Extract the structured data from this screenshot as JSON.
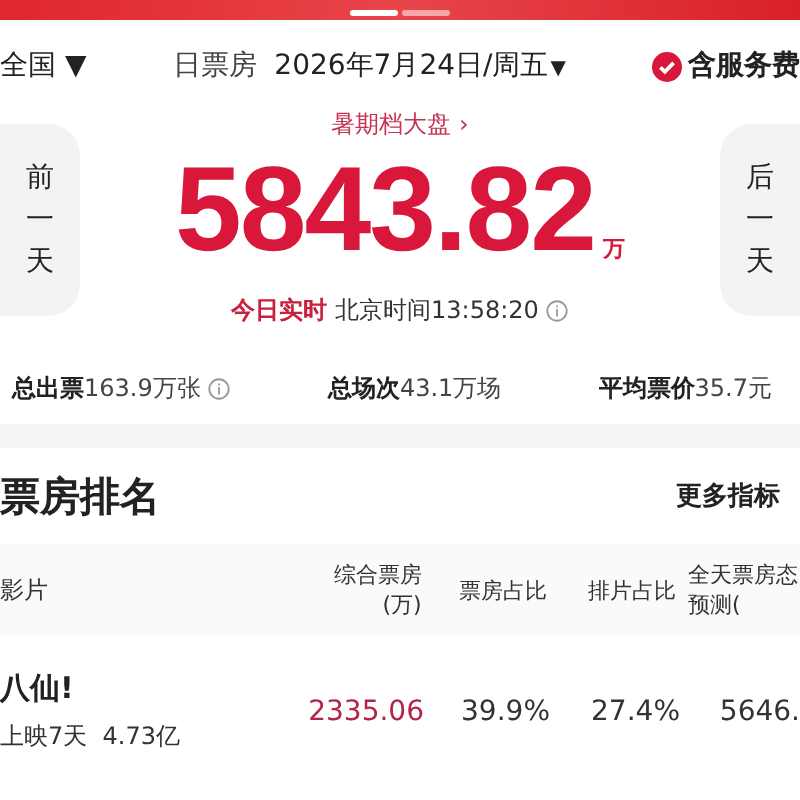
{
  "header": {
    "region": "全国",
    "caret": "▼",
    "board_label": "日票房",
    "date": "2026年7月24日/周五",
    "date_caret": "▼",
    "service_fee": {
      "label": "含服务费",
      "checked": true
    }
  },
  "summary": {
    "season_link": "暑期档大盘",
    "season_chevron": "›",
    "amount": "5843.82",
    "unit": "万",
    "live_label": "今日实时",
    "time": "北京时间13:58:20",
    "prev_day": "前一天",
    "next_day": "后一天"
  },
  "stats": [
    {
      "label": "总出票",
      "value": "163.9万张",
      "info": true
    },
    {
      "label": "总场次",
      "value": "43.1万场",
      "info": false
    },
    {
      "label": "平均票价",
      "value": "35.7元",
      "info": false
    }
  ],
  "ranking": {
    "title": "票房排名",
    "more": "更多指标",
    "columns": [
      "影片",
      "综合票房(万)",
      "票房占比",
      "排片占比",
      "全天票房态预测("
    ],
    "rows": [
      {
        "film": "八仙!",
        "days": "上映7天",
        "total": "4.73亿",
        "box_office": "2335.06",
        "share": "39.9%",
        "screenings": "27.4%",
        "forecast": "5646."
      }
    ]
  }
}
